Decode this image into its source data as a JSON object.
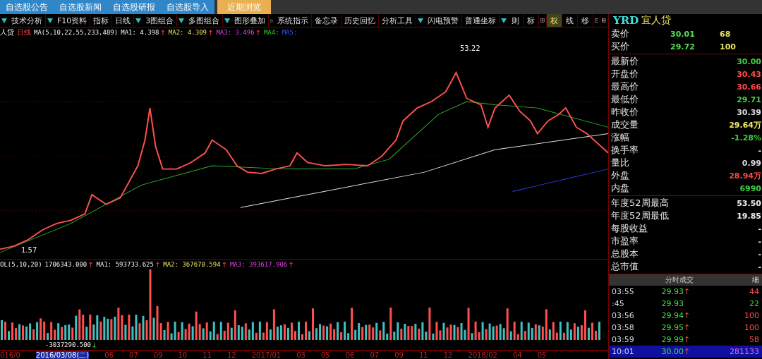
{
  "top_tabs": [
    {
      "label": "自选股公告",
      "selected": false
    },
    {
      "label": "自选股新闻",
      "selected": false
    },
    {
      "label": "自选股研报",
      "selected": false
    },
    {
      "label": "自选股导入",
      "selected": false
    },
    {
      "label": "近期浏览",
      "selected": true
    }
  ],
  "toolbar": [
    {
      "label": "技术分析",
      "kind": "dropdown"
    },
    {
      "label": "F10资料",
      "kind": "plain"
    },
    {
      "label": "指标",
      "kind": "plain"
    },
    {
      "label": "日线",
      "kind": "dropdown"
    },
    {
      "label": "3图组合",
      "kind": "dropdown"
    },
    {
      "label": "多图组合",
      "kind": "dropdown"
    },
    {
      "label": "图形叠加",
      "kind": "lock"
    },
    {
      "label": "系统指示",
      "kind": "plain"
    },
    {
      "label": "备忘录",
      "kind": "plain"
    },
    {
      "label": "历史回忆",
      "kind": "plain"
    },
    {
      "label": "分析工具",
      "kind": "dropdown"
    },
    {
      "label": "闪电预警",
      "kind": "plain"
    },
    {
      "label": "普通坐标",
      "kind": "dropdown"
    }
  ],
  "tool_buttons": [
    {
      "kind": "text",
      "label": "则",
      "selected": false
    },
    {
      "kind": "text",
      "label": "标",
      "selected": false
    },
    {
      "kind": "grid",
      "selected": false
    },
    {
      "kind": "text",
      "label": "权",
      "selected": true
    },
    {
      "kind": "text",
      "label": "线",
      "selected": false
    },
    {
      "kind": "text",
      "label": "移",
      "selected": false
    },
    {
      "kind": "panel",
      "selected": false
    },
    {
      "kind": "sidebar",
      "selected": false
    }
  ],
  "stock": {
    "code": "YRD",
    "name": "宜人贷"
  },
  "price_legend": {
    "name": "人贷",
    "period": "日线",
    "params": "MA(5,10,22,55,233,489)",
    "items": [
      {
        "label": "MA1: 4.398",
        "arrow": "↑",
        "kind": "ma1"
      },
      {
        "label": "MA2: 4.309",
        "arrow": "↑",
        "kind": "ma2"
      },
      {
        "label": "MA3: 3.496",
        "arrow": "↑",
        "kind": "ma3"
      },
      {
        "label": "MA4:",
        "kind": "ma4"
      },
      {
        "label": "MA5:",
        "kind": "ma5"
      }
    ]
  },
  "price_chart": {
    "high_label": "53.22",
    "low_label": "1.57"
  },
  "volume_legend": {
    "params": "OL(5,10,20)",
    "items": [
      {
        "label": "1706343.000",
        "arrow": "↑",
        "kind": "vol"
      },
      {
        "label": "MA1: 593733.625",
        "arrow": "↑",
        "kind": "ma1"
      },
      {
        "label": "MA2: 367670.594",
        "arrow": "↑",
        "kind": "ma2"
      },
      {
        "label": "MA3: 393617.906",
        "arrow": "↑",
        "kind": "ma3"
      }
    ]
  },
  "volume_readout": {
    "label": "-3037290.500",
    "arrow": "↓"
  },
  "date_axis": [
    {
      "label": "016/0",
      "selected": false
    },
    {
      "label": "2016/03/08(二)",
      "selected": true
    },
    {
      "label": "06",
      "selected": false
    },
    {
      "label": "07",
      "selected": false
    },
    {
      "label": "09",
      "selected": false
    },
    {
      "label": "10",
      "selected": false
    },
    {
      "label": "11",
      "selected": false
    },
    {
      "label": "12",
      "selected": false
    },
    {
      "label": "2017/01",
      "selected": false
    },
    {
      "label": "03",
      "selected": false
    },
    {
      "label": "05",
      "selected": false
    },
    {
      "label": "06",
      "selected": false
    },
    {
      "label": "07",
      "selected": false
    },
    {
      "label": "09",
      "selected": false
    },
    {
      "label": "11",
      "selected": false
    },
    {
      "label": "12",
      "selected": false
    },
    {
      "label": "2018/02",
      "selected": false
    },
    {
      "label": "04",
      "selected": false
    },
    {
      "label": "05",
      "selected": false
    }
  ],
  "quote": {
    "bid_ask": [
      {
        "label": "卖价",
        "price": "30.01",
        "volume": "68"
      },
      {
        "label": "买价",
        "price": "29.72",
        "volume": "100"
      }
    ],
    "fields": [
      {
        "label": "最新价",
        "value": "30.00",
        "color": "#40d040"
      },
      {
        "label": "开盘价",
        "value": "30.43",
        "color": "#ff4a4a"
      },
      {
        "label": "最高价",
        "value": "30.66",
        "color": "#ff4a4a"
      },
      {
        "label": "最低价",
        "value": "29.71",
        "color": "#40d040"
      },
      {
        "label": "昨收价",
        "value": "30.39",
        "color": "#d8d8d8"
      },
      {
        "label": "成交量",
        "value": "29.64万",
        "color": "#f0f060"
      },
      {
        "label": "涨幅",
        "value": "-1.28%",
        "color": "#40d040"
      },
      {
        "label": "换手率",
        "value": "-"
      },
      {
        "label": "量比",
        "value": "0.99",
        "color": "#d8d8d8"
      },
      {
        "label": "外盘",
        "value": "28.94万",
        "color": "#ff4a4a"
      },
      {
        "label": "内盘",
        "value": "6990",
        "color": "#40d040"
      }
    ],
    "annual": [
      {
        "label": "年度52周最高",
        "value": "53.50"
      },
      {
        "label": "年度52周最低",
        "value": "19.85"
      },
      {
        "label": "每股收益",
        "value": "-"
      },
      {
        "label": "市盈率",
        "value": "-"
      },
      {
        "label": "总股本",
        "value": "-"
      },
      {
        "label": "总市值",
        "value": "-"
      }
    ]
  },
  "trades": {
    "title": "分时成交",
    "side_tab": "细",
    "rows": [
      {
        "time": "03:55",
        "price": "29.93",
        "arrow": "↑",
        "volume": "44",
        "color": "#ff4a4a",
        "selected": false
      },
      {
        "time": ":45",
        "price": "29.93",
        "volume": "22",
        "color": "#40d040",
        "selected": false
      },
      {
        "time": "03:56",
        "price": "29.94",
        "arrow": "↑",
        "volume": "100",
        "color": "#ff4a4a",
        "selected": false
      },
      {
        "time": "03:58",
        "price": "29.95",
        "arrow": "↑",
        "volume": "100",
        "color": "#ff4a4a",
        "selected": false
      },
      {
        "time": "03:59",
        "price": "29.99",
        "arrow": "↑",
        "volume": "58",
        "color": "#ff4a4a",
        "selected": false
      },
      {
        "time": "10:01",
        "price": "30.00",
        "arrow": "↑",
        "volume": "281133",
        "color": "#e070e0",
        "selected": true
      }
    ]
  }
}
